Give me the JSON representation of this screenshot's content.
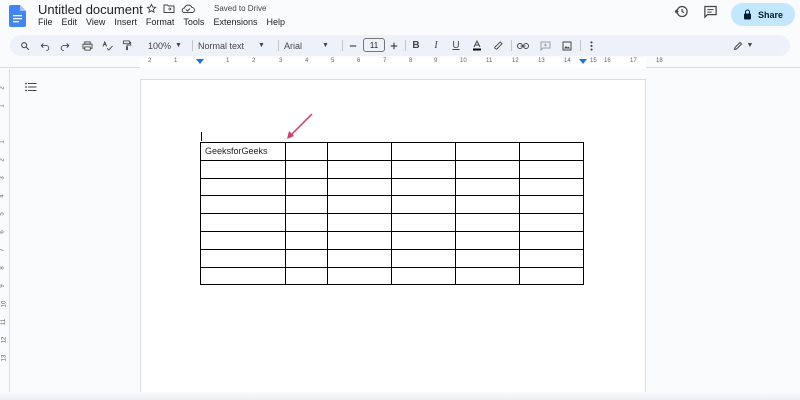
{
  "title_bar": {
    "doc_title": "Untitled document",
    "saved_status": "Saved to Drive",
    "share_label": "Share"
  },
  "menu": {
    "items": [
      "File",
      "Edit",
      "View",
      "Insert",
      "Format",
      "Tools",
      "Extensions",
      "Help"
    ]
  },
  "toolbar": {
    "zoom": "100%",
    "style": "Normal text",
    "font": "Arial",
    "font_size": "11",
    "icons": [
      "search-icon",
      "undo-icon",
      "redo-icon",
      "print-icon",
      "spellcheck-icon",
      "paint-format-icon",
      "minus-icon",
      "plus-icon",
      "bold-icon",
      "italic-icon",
      "underline-icon",
      "text-color-icon",
      "highlight-icon",
      "link-icon",
      "comment-icon",
      "image-icon",
      "more-icon",
      "editing-mode-icon"
    ]
  },
  "ruler": {
    "numbers": [
      "2",
      "1",
      "1",
      "2",
      "3",
      "4",
      "5",
      "6",
      "7",
      "8",
      "9",
      "10",
      "11",
      "12",
      "13",
      "14",
      "15",
      "16",
      "17",
      "18"
    ]
  },
  "vertical_ruler": {
    "numbers": [
      "2",
      "1",
      "1",
      "2",
      "3",
      "4",
      "5",
      "6",
      "7",
      "8",
      "9",
      "10",
      "11",
      "12",
      "13"
    ]
  },
  "document": {
    "table": {
      "rows": [
        [
          "GeeksforGeeks",
          "",
          "",
          "",
          "",
          ""
        ],
        [
          "",
          "",
          "",
          "",
          "",
          ""
        ],
        [
          "",
          "",
          "",
          "",
          "",
          ""
        ],
        [
          "",
          "",
          "",
          "",
          "",
          ""
        ],
        [
          "",
          "",
          "",
          "",
          "",
          ""
        ],
        [
          "",
          "",
          "",
          "",
          "",
          ""
        ],
        [
          "",
          "",
          "",
          "",
          "",
          ""
        ],
        [
          "",
          "",
          "",
          "",
          "",
          ""
        ]
      ]
    }
  },
  "colors": {
    "accent": "#1a73e8",
    "share_bg": "#c2e7ff",
    "toolbar_bg": "#edf2fa",
    "arrow": "#d03d6a",
    "doc_icon": "#4285f4"
  }
}
